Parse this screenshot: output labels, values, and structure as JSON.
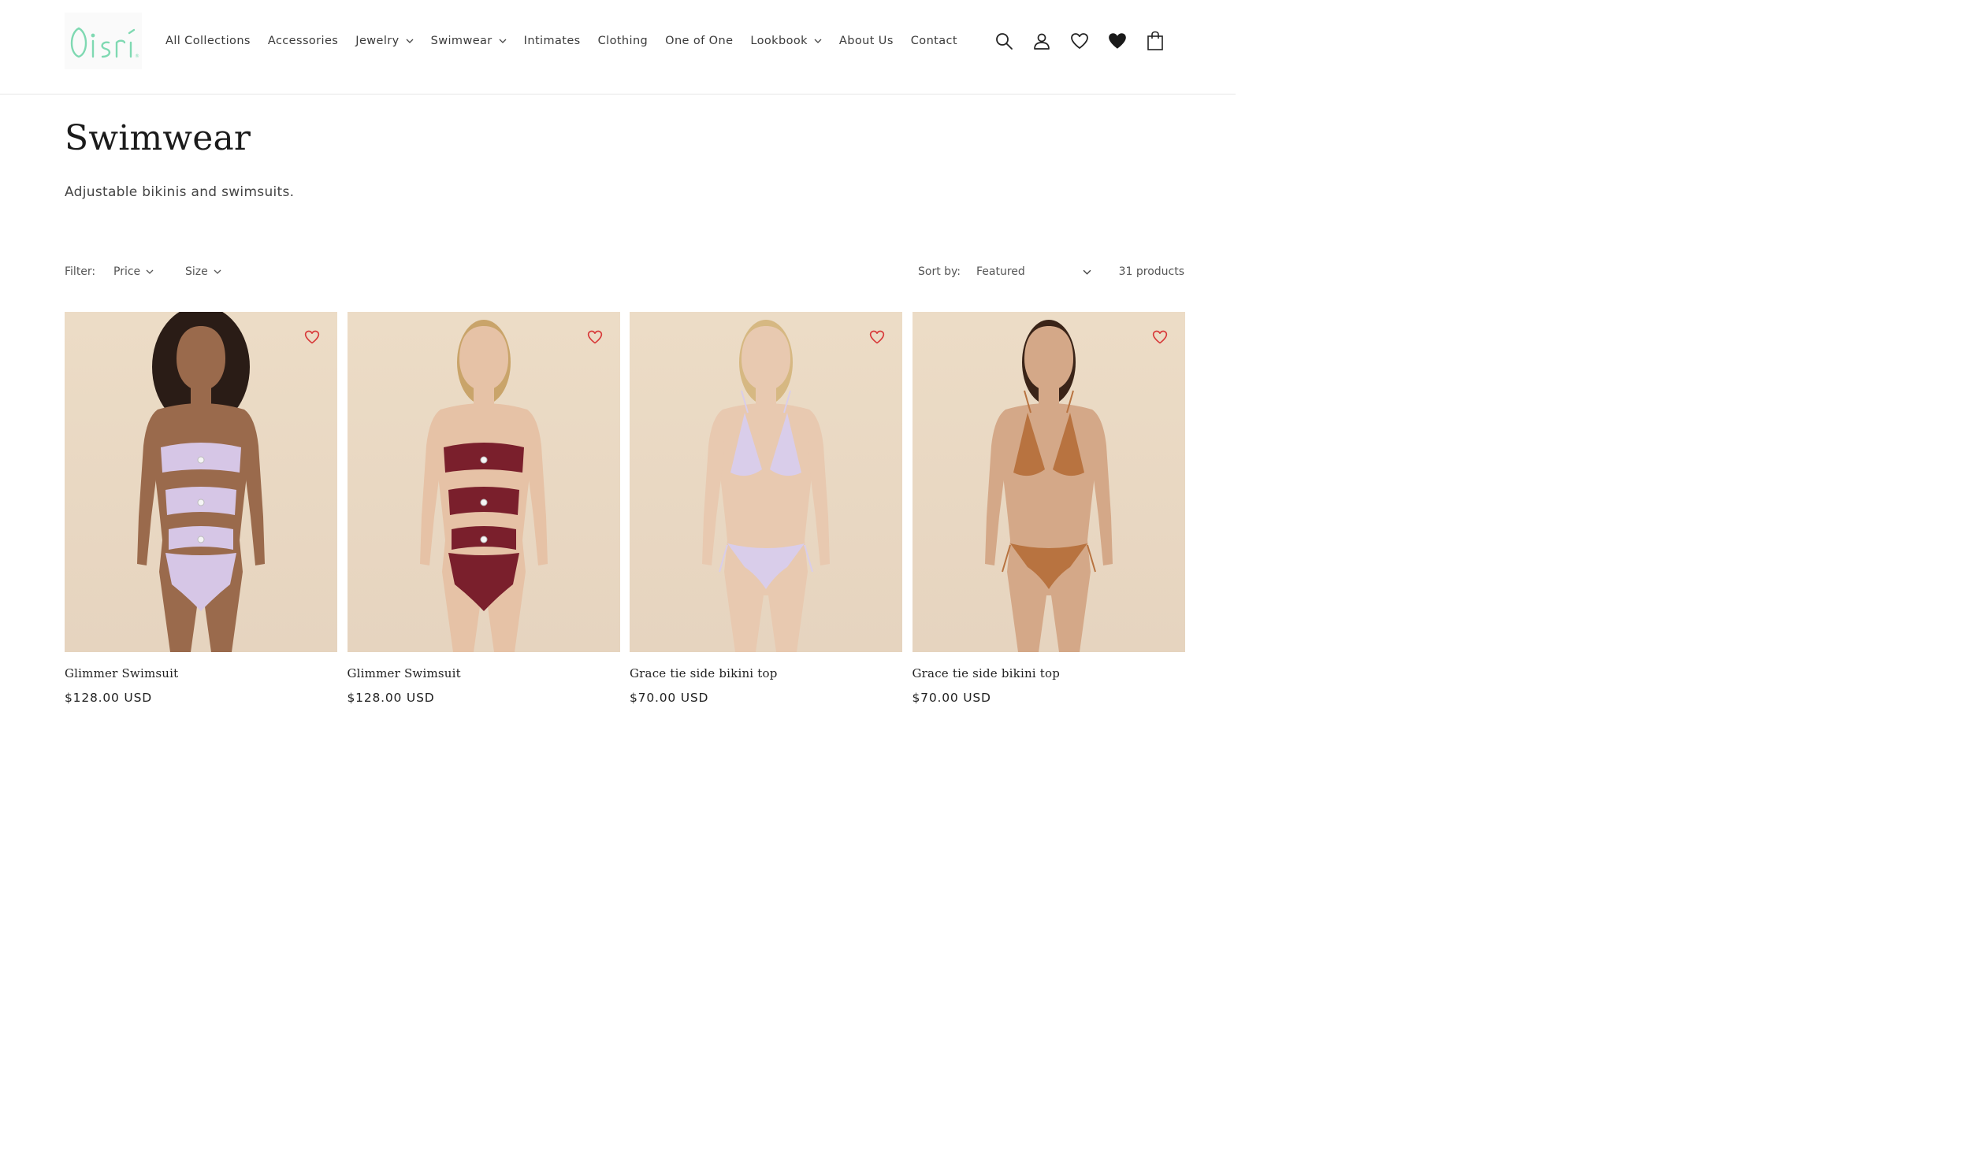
{
  "brand": {
    "logo_text": "Oisri",
    "logo_color": "#7fd9b2"
  },
  "nav": {
    "items": [
      {
        "label": "All Collections",
        "has_dropdown": false
      },
      {
        "label": "Accessories",
        "has_dropdown": false
      },
      {
        "label": "Jewelry",
        "has_dropdown": true
      },
      {
        "label": "Swimwear",
        "has_dropdown": true
      },
      {
        "label": "Intimates",
        "has_dropdown": false
      },
      {
        "label": "Clothing",
        "has_dropdown": false
      },
      {
        "label": "One of One",
        "has_dropdown": false
      },
      {
        "label": "Lookbook",
        "has_dropdown": true
      },
      {
        "label": "About Us",
        "has_dropdown": false
      },
      {
        "label": "Contact",
        "has_dropdown": false
      }
    ]
  },
  "header_icons": [
    "search-icon",
    "account-icon",
    "wishlist-outline-icon",
    "wishlist-filled-icon",
    "cart-icon"
  ],
  "collection": {
    "title": "Swimwear",
    "description": "Adjustable bikinis and swimsuits."
  },
  "filters": {
    "label": "Filter:",
    "options": [
      "Price",
      "Size"
    ],
    "sort_label": "Sort by:",
    "sort_value": "Featured",
    "product_count": "31 products"
  },
  "products": [
    {
      "name": "Glimmer Swimsuit",
      "price": "$128.00 USD",
      "garment_color": "#d6c6e6",
      "skin": "#9a6a4c",
      "hair": "#2a1c16",
      "style": "cutout"
    },
    {
      "name": "Glimmer Swimsuit",
      "price": "$128.00 USD",
      "garment_color": "#7a1f2c",
      "skin": "#e6c2a6",
      "hair": "#c9a46a",
      "style": "cutout"
    },
    {
      "name": "Grace tie side bikini top",
      "price": "$70.00 USD",
      "garment_color": "#d9cdea",
      "skin": "#e8c9b0",
      "hair": "#d6b882",
      "style": "bikini"
    },
    {
      "name": "Grace tie side bikini top",
      "price": "$70.00 USD",
      "garment_color": "#b87340",
      "skin": "#d4a888",
      "hair": "#3a2418",
      "style": "bikini"
    }
  ],
  "colors": {
    "wishlist_heart": "#d83a3a",
    "photo_bg": "#ead8c2"
  }
}
